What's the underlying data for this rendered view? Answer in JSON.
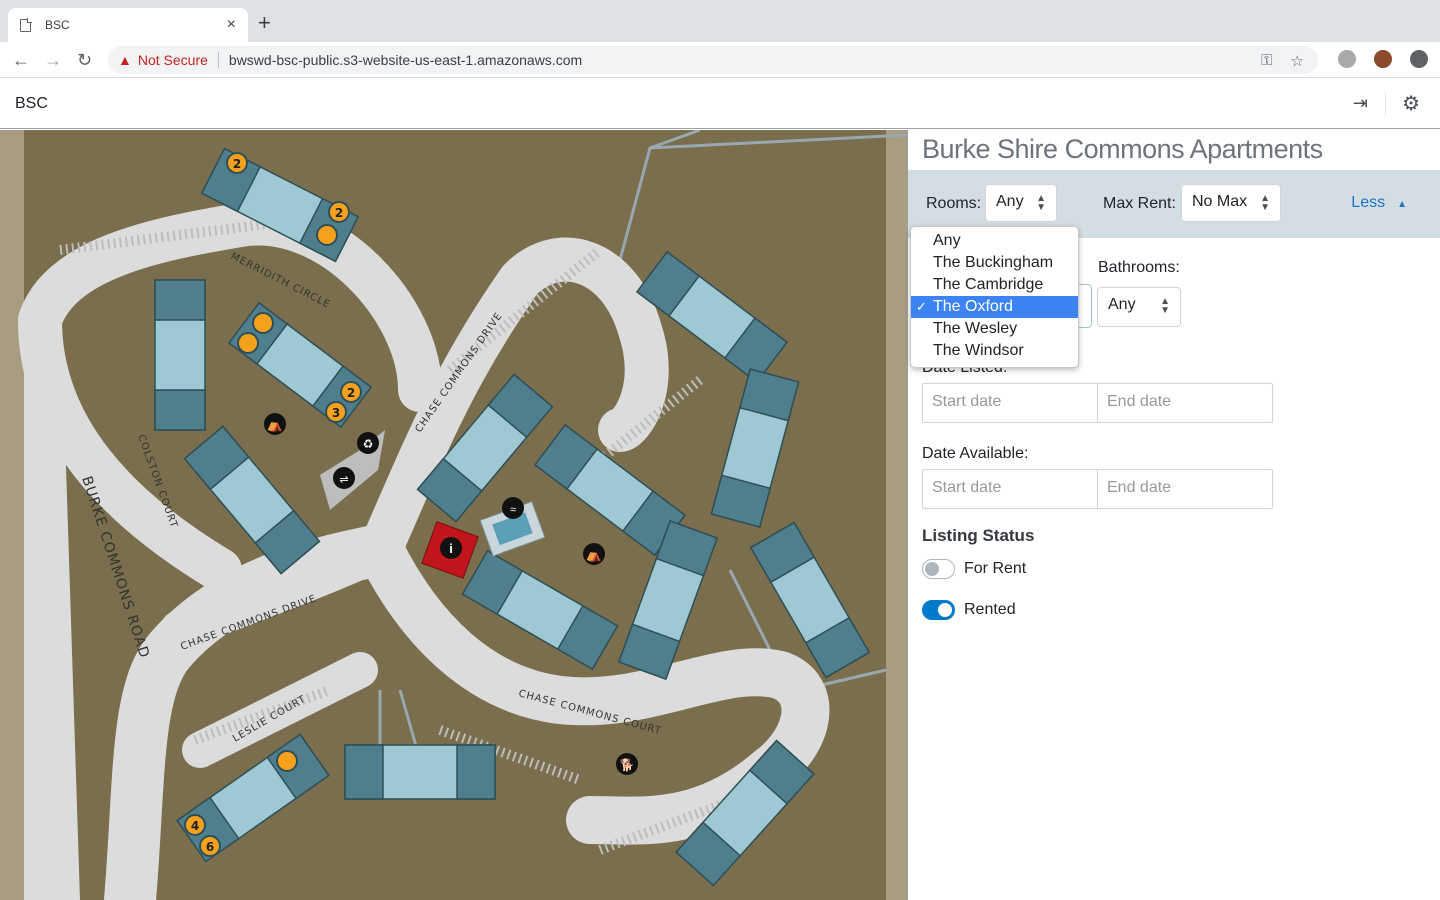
{
  "browser": {
    "tab_title": "BSC",
    "new_tab": "+",
    "close_tab": "×",
    "security_label": "Not Secure",
    "url": "bwswd-bsc-public.s3-website-us-east-1.amazonaws.com"
  },
  "app": {
    "brand": "BSC"
  },
  "panel": {
    "title": "Burke Shire Commons Apartments",
    "rooms_label": "Rooms:",
    "rooms_value": "Any",
    "max_rent_label": "Max Rent:",
    "max_rent_value": "No Max",
    "less_label": "Less",
    "bathrooms_label": "Bathrooms:",
    "bathrooms_value": "Any",
    "date_listed_label": "Date Listed:",
    "date_available_label": "Date Available:",
    "start_placeholder": "Start date",
    "end_placeholder": "End date",
    "listing_status_title": "Listing Status",
    "for_rent_label": "For Rent",
    "for_rent_on": false,
    "rented_label": "Rented",
    "rented_on": true
  },
  "floorplan_dropdown": {
    "options": [
      "Any",
      "The Buckingham",
      "The Cambridge",
      "The Oxford",
      "The Wesley",
      "The Windsor"
    ],
    "selected": "The Oxford"
  },
  "map": {
    "streets": {
      "merriddith": "MERRIDITH CIRCLE",
      "colston": "COLSTON COURT",
      "burke": "BURKE   COMMONS   ROAD",
      "chase_drive_1": "CHASE COMMONS DRIVE",
      "chase_drive_2": "CHASE COMMONS DRIVE",
      "chase_court": "CHASE COMMONS COURT",
      "leslie": "LESLIE COURT"
    },
    "markers": {
      "m1": "2",
      "m2": "2",
      "m3": "2",
      "m4": "3",
      "m5": "4",
      "m6": "6"
    },
    "colors": {
      "ground": "#8c8060",
      "road": "#dcdcdc",
      "building_dark": "#4f7f8c",
      "building_light": "#9ec8d2",
      "marker": "#f5a11c",
      "office": "#c0161b"
    }
  }
}
